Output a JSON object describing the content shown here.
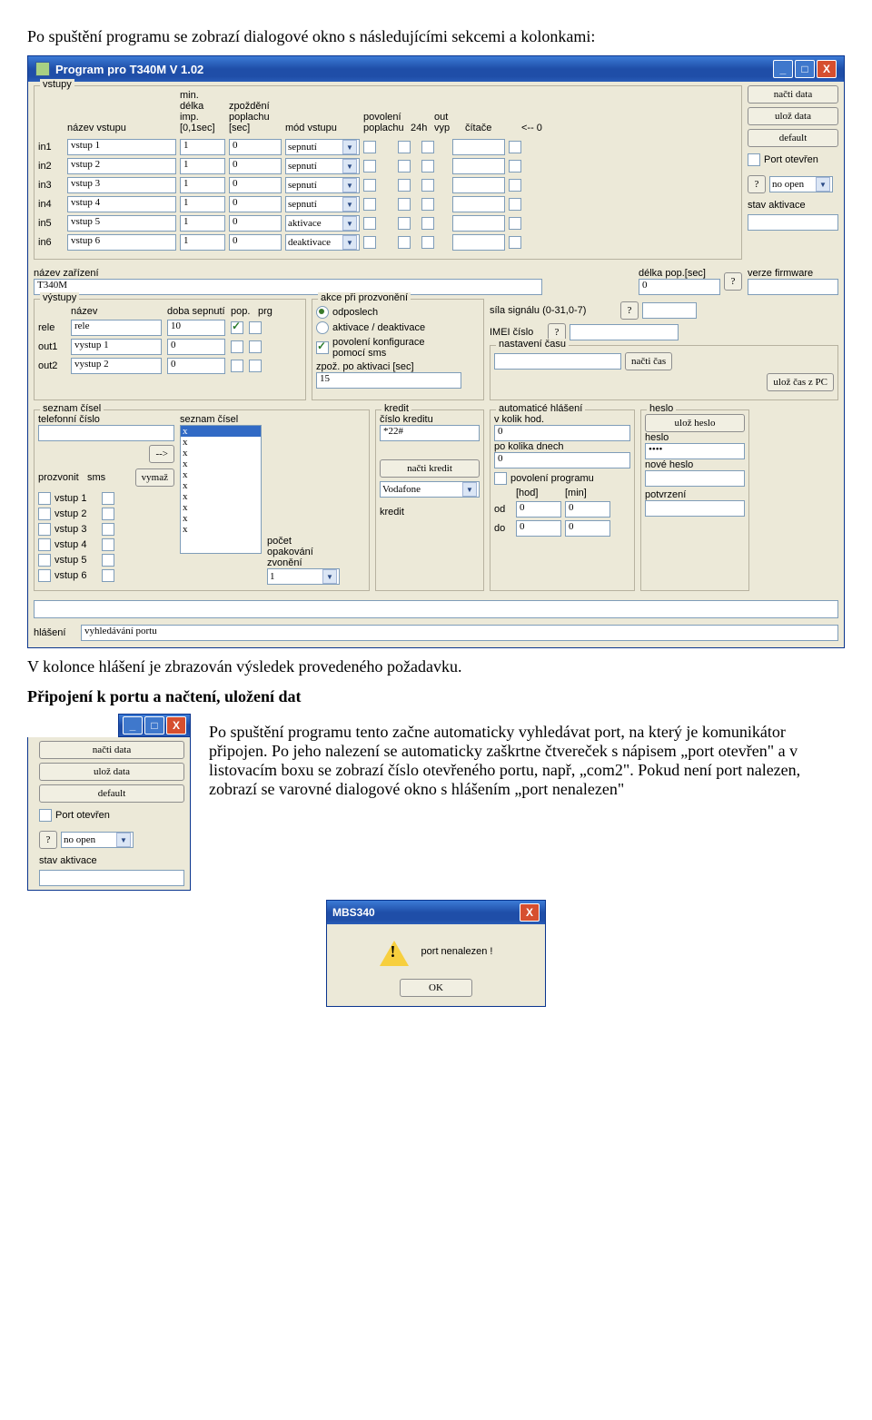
{
  "doc": {
    "intro": "Po spuštění programu se zobrazí dialogové okno s následujícími sekcemi a kolonkami:",
    "after": "V kolonce hlášení je zbrazován výsledek provedeného požadavku.",
    "h_port": "Připojení k portu a načtení, uložení dat",
    "para_port": "Po spuštění programu tento začne automaticky vyhledávat port, na který je komunikátor připojen. Po jeho nalezení se automaticky zaškrtne čtvereček s nápisem „port otevřen\" a v listovacím boxu se zobrazí číslo otevřeného portu, např, „com2\". Pokud není port nalezen, zobrazí se varovné dialogové okno s hlášením „port nenalezen\""
  },
  "win": {
    "title": "Program pro T340M V 1.02"
  },
  "vstupy": {
    "legend": "vstupy",
    "headers": {
      "nazev": "název vstupu",
      "min": "min. délka imp. [0,1sec]",
      "zpozd": "zpoždění poplachu [sec]",
      "mod": "mód vstupu",
      "povol": "povolení poplachu",
      "h24": "24h",
      "outvyp": "out vyp",
      "citace": "čítače",
      "arrow0": "<-- 0"
    },
    "rows": [
      {
        "id": "in1",
        "nazev": "vstup 1",
        "min": "1",
        "zp": "0",
        "mod": "sepnutí"
      },
      {
        "id": "in2",
        "nazev": "vstup 2",
        "min": "1",
        "zp": "0",
        "mod": "sepnutí"
      },
      {
        "id": "in3",
        "nazev": "vstup 3",
        "min": "1",
        "zp": "0",
        "mod": "sepnutí"
      },
      {
        "id": "in4",
        "nazev": "vstup 4",
        "min": "1",
        "zp": "0",
        "mod": "sepnutí"
      },
      {
        "id": "in5",
        "nazev": "vstup 5",
        "min": "1",
        "zp": "0",
        "mod": "aktivace"
      },
      {
        "id": "in6",
        "nazev": "vstup 6",
        "min": "1",
        "zp": "0",
        "mod": "deaktivace"
      }
    ]
  },
  "side": {
    "nacti": "načti data",
    "uloz": "ulož data",
    "def": "default",
    "port_chk": "Port otevřen",
    "q": "?",
    "port_sel": "no open",
    "stav": "stav aktivace"
  },
  "device": {
    "lbl": "název zařízení",
    "val": "T340M",
    "delka_lbl": "délka pop.[sec]",
    "delka_val": "0",
    "verze_lbl": "verze firmware",
    "verze_val": ""
  },
  "vystupy": {
    "legend": "výstupy",
    "h_nazev": "název",
    "h_doba": "doba sepnutí",
    "h_pop": "pop.",
    "h_prg": "prg",
    "rows": [
      {
        "id": "rele",
        "nazev": "rele",
        "doba": "10",
        "pop": true,
        "prg": false
      },
      {
        "id": "out1",
        "nazev": "vystup 1",
        "doba": "0",
        "pop": false,
        "prg": false
      },
      {
        "id": "out2",
        "nazev": "vystup 2",
        "doba": "0",
        "pop": false,
        "prg": false
      }
    ]
  },
  "akce": {
    "legend": "akce při prozvonění",
    "r1": "odposlech",
    "r2": "aktivace / deaktivace",
    "sms_lbl": "povolení konfigurace pomocí sms",
    "zpoz_lbl": "zpož. po aktivaci [sec]",
    "zpoz_val": "15"
  },
  "sig": {
    "lbl": "síla signálu (0-31,0-7)",
    "imei": "IMEI číslo",
    "nast": "nastavení času",
    "nacti_cas": "načti čas",
    "uloz_cas": "ulož čas z PC"
  },
  "seznam": {
    "legend": "seznam čísel",
    "tel_lbl": "telefonní číslo",
    "seznam_lbl": "seznam čísel",
    "arrow": "-->",
    "vymaz": "vymaž",
    "prozvonit": "prozvonit",
    "sms": "sms",
    "opak_lbl": "počet opakování zvonění",
    "opak_val": "1",
    "vstupy": [
      "vstup 1",
      "vstup 2",
      "vstup 3",
      "vstup 4",
      "vstup 5",
      "vstup 6"
    ]
  },
  "kredit": {
    "legend": "kredit",
    "cislo_lbl": "číslo kreditu",
    "cislo_val": "*22#",
    "nacti": "načti kredit",
    "oper": "Vodafone",
    "kredit_lbl": "kredit"
  },
  "auto": {
    "legend": "automaticé hlášení",
    "vkolik": "v kolik hod.",
    "vkolik_val": "0",
    "pokolika": "po kolika dnech",
    "pokolika_val": "0",
    "povol": "povolení programu",
    "hod": "[hod]",
    "min": "[min]",
    "od": "od",
    "do": "do",
    "od_h": "0",
    "od_m": "0",
    "do_h": "0",
    "do_m": "0"
  },
  "heslo": {
    "legend": "heslo",
    "btn": "ulož heslo",
    "heslo_lbl": "heslo",
    "heslo_val": "••••",
    "nove": "nové heslo",
    "pot": "potvrzení"
  },
  "hlaseni": {
    "lbl": "hlášení",
    "val": "vyhledávání portu"
  },
  "dlg": {
    "title": "MBS340",
    "msg": "port nenalezen !",
    "ok": "OK"
  }
}
